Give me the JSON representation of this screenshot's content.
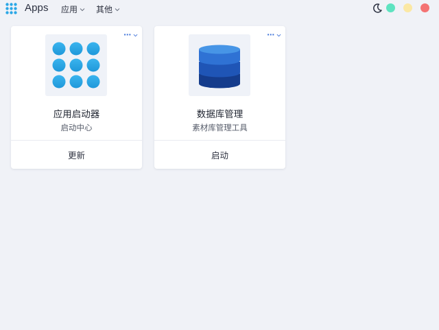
{
  "header": {
    "app_title": "Apps",
    "logo_icon": "grid-logo-icon",
    "menus": [
      {
        "label": "应用",
        "icon": "chevron-down-icon"
      },
      {
        "label": "其他",
        "icon": "chevron-down-icon"
      }
    ],
    "theme_icon": "moon-icon",
    "window_dots": [
      {
        "name": "green-dot",
        "color": "#5ee3c0"
      },
      {
        "name": "yellow-dot",
        "color": "#fbe8a4"
      },
      {
        "name": "red-dot",
        "color": "#f47373"
      }
    ]
  },
  "cards": [
    {
      "name": "应用启动器",
      "description": "启动中心",
      "action_label": "更新",
      "icon": "app-grid-icon",
      "more_label": "···"
    },
    {
      "name": "数据库管理",
      "description": "素材库管理工具",
      "action_label": "启动",
      "icon": "database-icon",
      "more_label": "···"
    }
  ],
  "colors": {
    "background": "#f0f2f7",
    "card": "#ffffff",
    "accent_blue": "#3a6fd8",
    "grid_dot": "#2aa7e6"
  }
}
